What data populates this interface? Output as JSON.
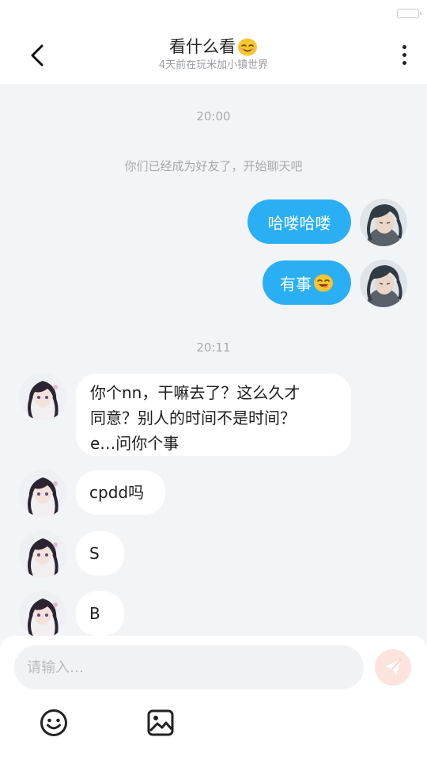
{
  "header": {
    "title": "看什么看",
    "title_emoji": "smile-emoji",
    "subtitle": "4天前在玩米加小镇世界"
  },
  "messages": {
    "time_1": "20:00",
    "system_note": "你们已经成为好友了，开始聊天吧",
    "out_1": "哈喽哈喽",
    "out_2": "有事",
    "out_2_emoji": "yum-emoji",
    "time_2": "20:11",
    "in_1_line_1": "你个nn，干嘛去了？这么久才",
    "in_1_line_2": "同意？别人的时间不是时间？",
    "in_1_line_3": "e…问你个事",
    "in_2": "cpdd吗",
    "in_3": "S",
    "in_4": "B"
  },
  "composer": {
    "placeholder": "请输入…",
    "send_icon": "send-icon",
    "emoji_icon": "emoji-icon",
    "image_icon": "image-icon"
  },
  "colors": {
    "outgoing_bubble": "#2aaff5",
    "incoming_bubble": "#ffffff",
    "chat_background": "#f3f4f6",
    "send_button": "#fde3dd"
  }
}
